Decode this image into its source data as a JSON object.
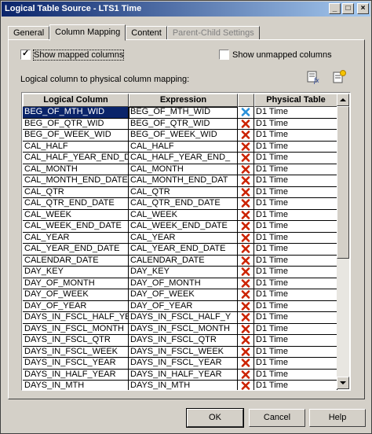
{
  "window": {
    "title": "Logical Table Source - LTS1 Time",
    "minimize": "_",
    "maximize": "□",
    "close": "×"
  },
  "tabs": [
    {
      "label": "General"
    },
    {
      "label": "Column Mapping"
    },
    {
      "label": "Content"
    },
    {
      "label": "Parent-Child Settings"
    }
  ],
  "options": {
    "show_mapped_label": "Show mapped columns",
    "show_mapped_checked": true,
    "show_unmapped_label": "Show unmapped columns",
    "show_unmapped_checked": false
  },
  "mapping_label": "Logical column to physical column mapping:",
  "icons": {
    "left": "edit-expression-icon",
    "right": "new-column-icon",
    "delete": "delete-mapping-icon"
  },
  "table": {
    "headers": [
      "Logical Column",
      "Expression",
      "",
      "Physical Table"
    ],
    "rows": [
      [
        "BEG_OF_MTH_WID",
        "BEG_OF_MTH_WID",
        "D1 Time"
      ],
      [
        "BEG_OF_QTR_WID",
        "BEG_OF_QTR_WID",
        "D1 Time"
      ],
      [
        "BEG_OF_WEEK_WID",
        "BEG_OF_WEEK_WID",
        "D1 Time"
      ],
      [
        "CAL_HALF",
        "CAL_HALF",
        "D1 Time"
      ],
      [
        "CAL_HALF_YEAR_END_D",
        "CAL_HALF_YEAR_END_",
        "D1 Time"
      ],
      [
        "CAL_MONTH",
        "CAL_MONTH",
        "D1 Time"
      ],
      [
        "CAL_MONTH_END_DATE",
        "CAL_MONTH_END_DAT",
        "D1 Time"
      ],
      [
        "CAL_QTR",
        "CAL_QTR",
        "D1 Time"
      ],
      [
        "CAL_QTR_END_DATE",
        "CAL_QTR_END_DATE",
        "D1 Time"
      ],
      [
        "CAL_WEEK",
        "CAL_WEEK",
        "D1 Time"
      ],
      [
        "CAL_WEEK_END_DATE",
        "CAL_WEEK_END_DATE",
        "D1 Time"
      ],
      [
        "CAL_YEAR",
        "CAL_YEAR",
        "D1 Time"
      ],
      [
        "CAL_YEAR_END_DATE",
        "CAL_YEAR_END_DATE",
        "D1 Time"
      ],
      [
        "CALENDAR_DATE",
        "CALENDAR_DATE",
        "D1 Time"
      ],
      [
        "DAY_KEY",
        "DAY_KEY",
        "D1 Time"
      ],
      [
        "DAY_OF_MONTH",
        "DAY_OF_MONTH",
        "D1 Time"
      ],
      [
        "DAY_OF_WEEK",
        "DAY_OF_WEEK",
        "D1 Time"
      ],
      [
        "DAY_OF_YEAR",
        "DAY_OF_YEAR",
        "D1 Time"
      ],
      [
        "DAYS_IN_FSCL_HALF_YE",
        "DAYS_IN_FSCL_HALF_Y",
        "D1 Time"
      ],
      [
        "DAYS_IN_FSCL_MONTH",
        "DAYS_IN_FSCL_MONTH",
        "D1 Time"
      ],
      [
        "DAYS_IN_FSCL_QTR",
        "DAYS_IN_FSCL_QTR",
        "D1 Time"
      ],
      [
        "DAYS_IN_FSCL_WEEK",
        "DAYS_IN_FSCL_WEEK",
        "D1 Time"
      ],
      [
        "DAYS_IN_FSCL_YEAR",
        "DAYS_IN_FSCL_YEAR",
        "D1 Time"
      ],
      [
        "DAYS_IN_HALF_YEAR",
        "DAYS_IN_HALF_YEAR",
        "D1 Time"
      ],
      [
        "DAYS_IN_MTH",
        "DAYS_IN_MTH",
        "D1 Time"
      ]
    ]
  },
  "buttons": {
    "ok": "OK",
    "cancel": "Cancel",
    "help": "Help"
  },
  "colors": {
    "title_start": "#0a246a",
    "title_end": "#a6caf0",
    "selection": "#0a246a",
    "delete_red": "#cc2200"
  }
}
